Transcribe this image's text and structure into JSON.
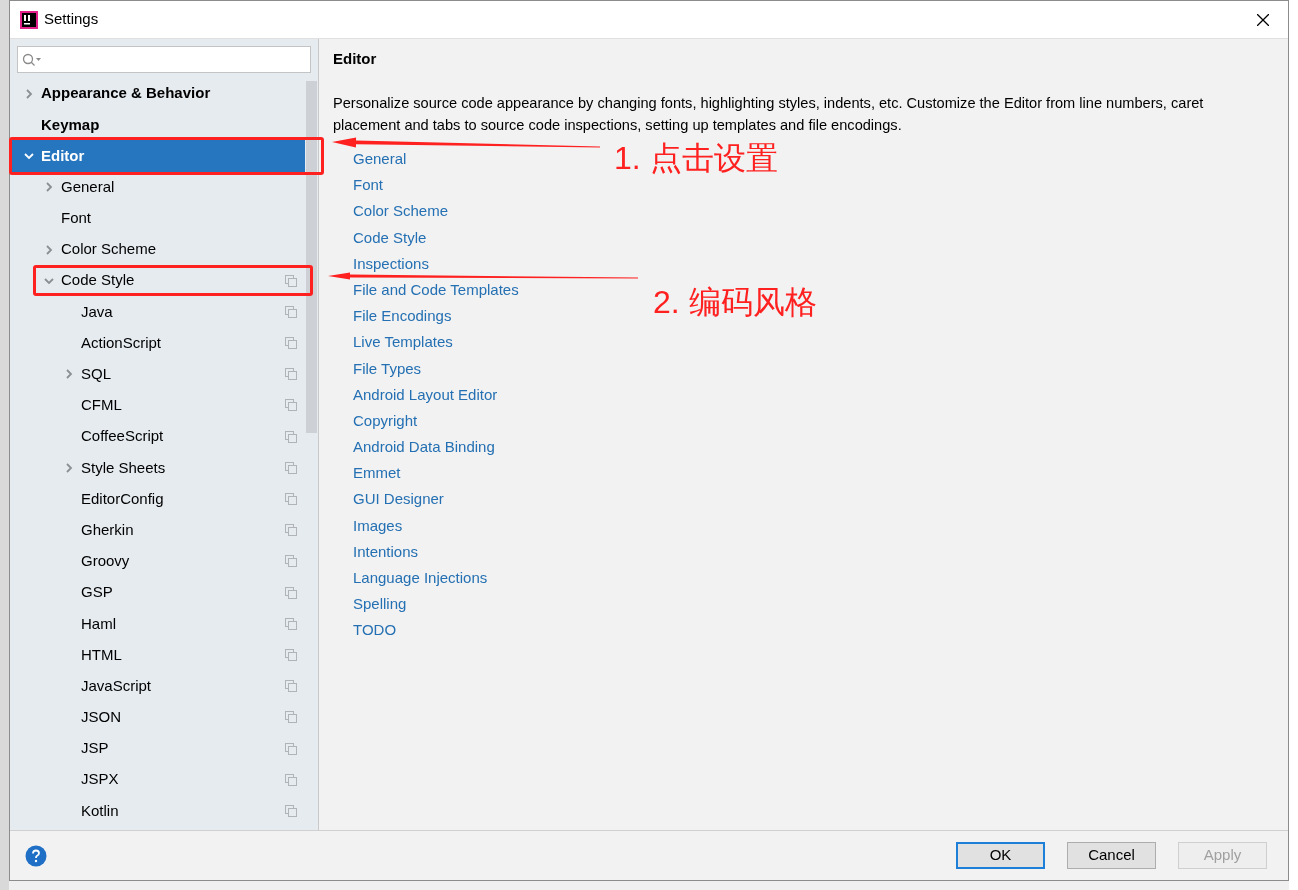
{
  "window": {
    "title": "Settings"
  },
  "tree": [
    {
      "label": "Appearance & Behavior",
      "expanded": false,
      "selected": false,
      "framed": false,
      "per_project": false
    },
    {
      "label": "Keymap",
      "selected": false,
      "framed": false,
      "per_project": false
    },
    {
      "label": "Editor",
      "expanded": true,
      "selected": true,
      "framed": true,
      "per_project": false,
      "children": [
        {
          "label": "General",
          "expanded": false,
          "selected": false,
          "framed": false,
          "per_project": false
        },
        {
          "label": "Font",
          "selected": false,
          "framed": false,
          "per_project": false
        },
        {
          "label": "Color Scheme",
          "expanded": false,
          "selected": false,
          "framed": false,
          "per_project": false
        },
        {
          "label": "Code Style",
          "expanded": true,
          "selected": false,
          "framed": true,
          "per_project": true,
          "children": [
            {
              "label": "Java",
              "selected": false,
              "framed": false,
              "per_project": true
            },
            {
              "label": "ActionScript",
              "selected": false,
              "framed": false,
              "per_project": true
            },
            {
              "label": "SQL",
              "expanded": false,
              "selected": false,
              "framed": false,
              "per_project": true
            },
            {
              "label": "CFML",
              "selected": false,
              "framed": false,
              "per_project": true
            },
            {
              "label": "CoffeeScript",
              "selected": false,
              "framed": false,
              "per_project": true
            },
            {
              "label": "Style Sheets",
              "expanded": false,
              "selected": false,
              "framed": false,
              "per_project": true
            },
            {
              "label": "EditorConfig",
              "selected": false,
              "framed": false,
              "per_project": true
            },
            {
              "label": "Gherkin",
              "selected": false,
              "framed": false,
              "per_project": true
            },
            {
              "label": "Groovy",
              "selected": false,
              "framed": false,
              "per_project": true
            },
            {
              "label": "GSP",
              "selected": false,
              "framed": false,
              "per_project": true
            },
            {
              "label": "Haml",
              "selected": false,
              "framed": false,
              "per_project": true
            },
            {
              "label": "HTML",
              "selected": false,
              "framed": false,
              "per_project": true
            },
            {
              "label": "JavaScript",
              "selected": false,
              "framed": false,
              "per_project": true
            },
            {
              "label": "JSON",
              "selected": false,
              "framed": false,
              "per_project": true
            },
            {
              "label": "JSP",
              "selected": false,
              "framed": false,
              "per_project": true
            },
            {
              "label": "JSPX",
              "selected": false,
              "framed": false,
              "per_project": true
            },
            {
              "label": "Kotlin",
              "selected": false,
              "framed": false,
              "per_project": true
            }
          ]
        }
      ]
    }
  ],
  "content": {
    "title": "Editor",
    "description": "Personalize source code appearance by changing fonts, highlighting styles, indents, etc. Customize the Editor from line numbers, caret placement and tabs to source code inspections, setting up templates and file encodings.",
    "links": [
      "General",
      "Font",
      "Color Scheme",
      "Code Style",
      "Inspections",
      "File and Code Templates",
      "File Encodings",
      "Live Templates",
      "File Types",
      "Android Layout Editor",
      "Copyright",
      "Android Data Binding",
      "Emmet",
      "GUI Designer",
      "Images",
      "Intentions",
      "Language Injections",
      "Spelling",
      "TODO"
    ]
  },
  "buttons": [
    {
      "label": "OK",
      "kind": "default",
      "disabled": false
    },
    {
      "label": "Cancel",
      "kind": "normal",
      "disabled": false
    },
    {
      "label": "Apply",
      "kind": "normal",
      "disabled": true
    }
  ],
  "annotations": [
    {
      "label": "1. 点击设置"
    },
    {
      "label": "2. 编码风格"
    }
  ]
}
